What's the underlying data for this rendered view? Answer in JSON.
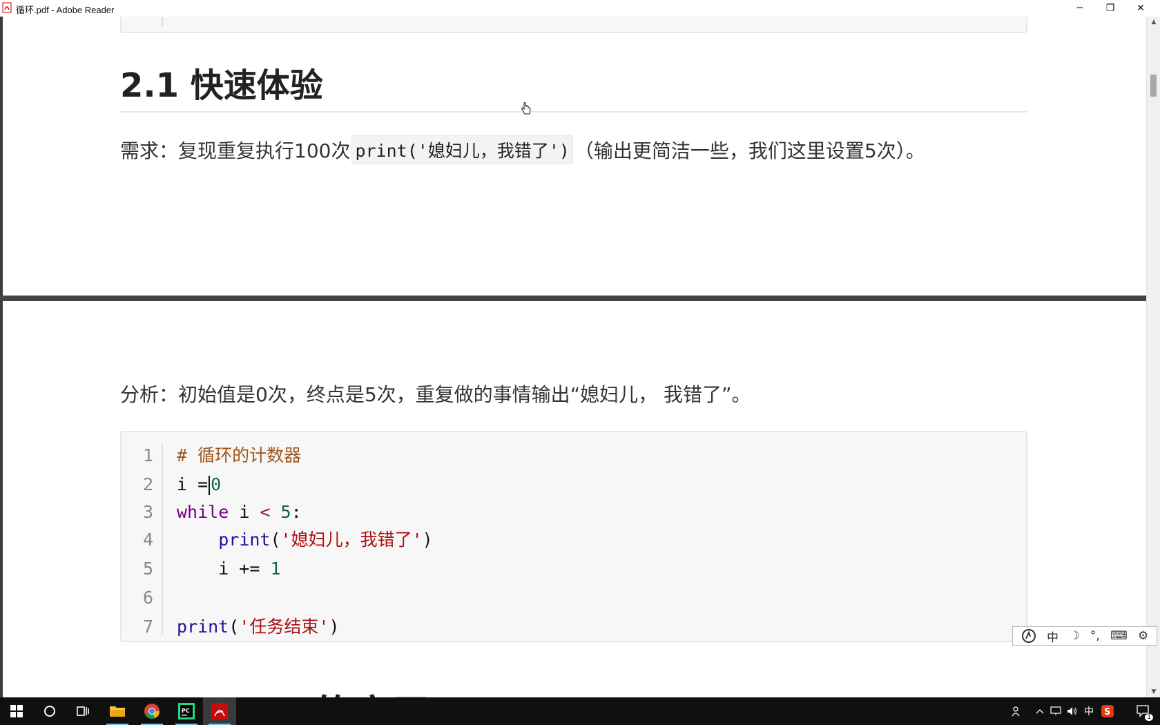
{
  "window": {
    "title": "循环.pdf - Adobe Reader",
    "minimize_glyph": "─",
    "restore_glyph": "❐",
    "close_glyph": "✕"
  },
  "document": {
    "heading": "2.1 快速体验",
    "requirement": {
      "prefix": "需求：复现重复执行100次",
      "code": "print('媳妇儿，我错了')",
      "suffix": "（输出更简洁一些，我们这里设置5次）。"
    },
    "analysis": "分析：初始值是0次，终点是5次，重复做的事情输出“媳妇儿， 我错了”。",
    "code_lines": [
      {
        "num": "1",
        "parts": [
          "# 循环的计数器"
        ]
      },
      {
        "num": "2",
        "parts": [
          "i =",
          "0"
        ]
      },
      {
        "num": "3",
        "parts": [
          "while",
          " i ",
          "<",
          " ",
          "5",
          ":"
        ]
      },
      {
        "num": "4",
        "parts": [
          "    ",
          "print",
          "(",
          "'媳妇儿，我错了'",
          ")"
        ]
      },
      {
        "num": "5",
        "parts": [
          "    i += ",
          "1"
        ]
      },
      {
        "num": "6",
        "parts": [
          ""
        ]
      },
      {
        "num": "7",
        "parts": [
          "print",
          "(",
          "'任务结束'",
          ")"
        ]
      }
    ],
    "next_heading_partial": "三、while的应用"
  },
  "ime_toolbar": {
    "mode_label": "中",
    "moon_glyph": "☽",
    "punct_glyph": "°,",
    "keyboard_glyph": "⌨",
    "settings_glyph": "⚙"
  },
  "taskbar": {
    "tray_lang": "中",
    "notification_count": "1"
  },
  "colors": {
    "accent_taskbar": "#76b9ed",
    "comment": "#a0561a",
    "keyword": "#770088",
    "number": "#116644",
    "string": "#aa1111"
  }
}
